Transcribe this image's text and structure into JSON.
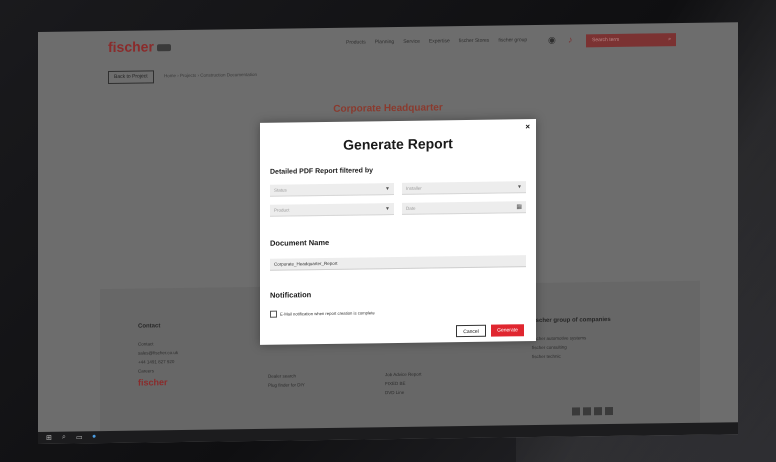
{
  "header": {
    "logo": "fischer",
    "nav": [
      "Products",
      "Planning",
      "Service",
      "Expertise",
      "fischer Stores",
      "fischer group"
    ],
    "search_placeholder": "Search term"
  },
  "toolbar": {
    "back_label": "Back to Project",
    "breadcrumb": "Home  ›  Projects  ›  Construction Documentation"
  },
  "page": {
    "title": "Corporate Headquarter"
  },
  "modal": {
    "close_label": "×",
    "title": "Generate Report",
    "subtitle": "Detailed PDF Report filtered by",
    "filters": {
      "status": "Status",
      "installer": "Installer",
      "product": "Product",
      "date": "Date"
    },
    "document_name_heading": "Document Name",
    "document_name_value": "Corporate_Headquarter_Report",
    "notification_heading": "Notification",
    "notification_checkbox_label": "E-Mail notification when report creation is complete",
    "notification_checked": false,
    "cancel_label": "Cancel",
    "generate_label": "Generate"
  },
  "footer": {
    "contact_heading": "Contact",
    "contact_lines": [
      "Contact",
      "sales@fischer.co.uk",
      "+44 1491 827 920",
      "Careers"
    ],
    "col2_lines": [
      "Dealer search",
      "Plug finder for DIY"
    ],
    "col3_lines": [
      "Job Advice Report",
      "FIXED BE",
      "DVD Line"
    ],
    "group_heading": "fischer group of companies",
    "group_lines": [
      "fischer automotive systems",
      "fischer consulting",
      "fischer technic"
    ],
    "footer_logo": "fischer"
  },
  "colors": {
    "accent": "#e0262f",
    "brand_dark": "#8a2b2b"
  }
}
